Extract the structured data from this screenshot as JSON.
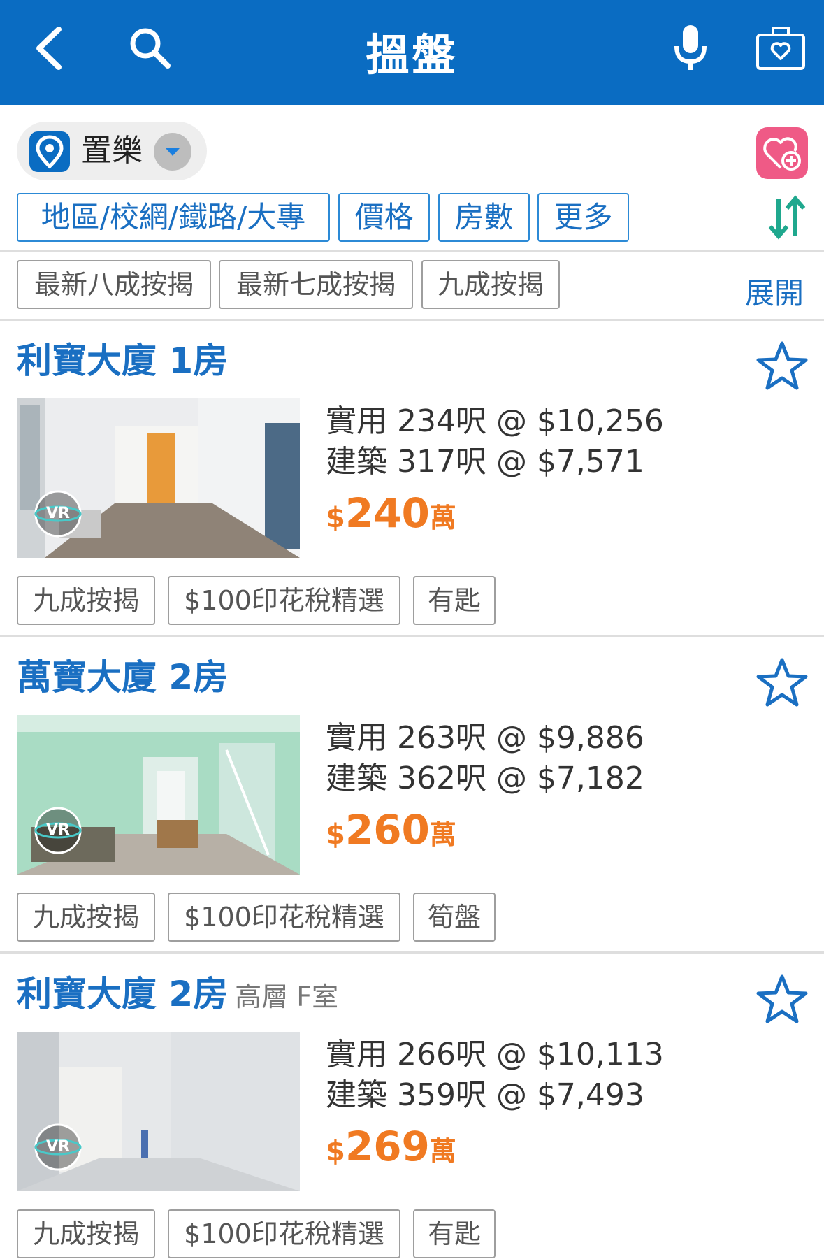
{
  "header": {
    "title": "搵盤",
    "icons": [
      "back-icon",
      "search-icon",
      "mic-icon",
      "saved-bag-icon"
    ],
    "bg_color": "#0a6cc2"
  },
  "location": {
    "name": "置樂",
    "pin_icon": "location-pin-icon",
    "dropdown_icon": "chevron-down-icon"
  },
  "favorite_add_icon": "heart-plus-icon",
  "filters": [
    "地區/校網/鐵路/大專",
    "價格",
    "房數",
    "更多"
  ],
  "sort_icon": "sort-arrows-icon",
  "quick_tags": [
    "最新八成按揭",
    "最新七成按揭",
    "九成按揭"
  ],
  "expand_label": "展開",
  "listings": [
    {
      "title": "利寶大廈 1房",
      "subtitle": "",
      "saleable": "實用 234呎 @ $10,256",
      "gross": "建築 317呎 @ $7,571",
      "price_currency": "$",
      "price_value": "240",
      "price_unit": "萬",
      "vr": "VR",
      "tags": [
        "九成按揭",
        "$100印花稅精選",
        "有匙"
      ]
    },
    {
      "title": "萬寶大廈 2房",
      "subtitle": "",
      "saleable": "實用 263呎 @ $9,886",
      "gross": "建築 362呎 @ $7,182",
      "price_currency": "$",
      "price_value": "260",
      "price_unit": "萬",
      "vr": "VR",
      "tags": [
        "九成按揭",
        "$100印花稅精選",
        "筍盤"
      ]
    },
    {
      "title": "利寶大廈 2房",
      "subtitle": "高層 F室",
      "saleable": "實用 266呎 @ $10,113",
      "gross": "建築 359呎 @ $7,493",
      "price_currency": "$",
      "price_value": "269",
      "price_unit": "萬",
      "vr": "VR",
      "tags": [
        "九成按揭",
        "$100印花稅精選",
        "有匙"
      ]
    }
  ],
  "colors": {
    "accent": "#1a6fc2",
    "price": "#f07a22",
    "favorite": "#ef5a86"
  }
}
